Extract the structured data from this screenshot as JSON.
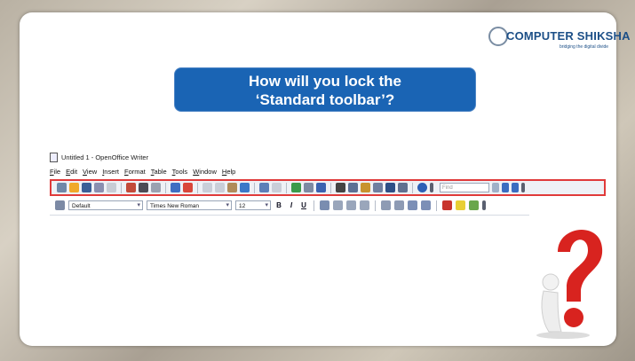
{
  "logo": {
    "name": "COMPUTER SHIKSHA",
    "tagline": "bridging the digital divide"
  },
  "question": {
    "line1": "How will you lock the",
    "line2": "‘Standard toolbar’?"
  },
  "app": {
    "window_title": "Untitled 1 - OpenOffice Writer",
    "menu": [
      "File",
      "Edit",
      "View",
      "Insert",
      "Format",
      "Table",
      "Tools",
      "Window",
      "Help"
    ],
    "find_placeholder": "Find"
  },
  "formatting": {
    "style": "Default",
    "font": "Times New Roman",
    "size": "12",
    "bold": "B",
    "italic": "I",
    "underline": "U"
  },
  "colors": {
    "title_bg": "#1a64b4",
    "highlight": "#e03a3a",
    "question_mark": "#d8231f"
  }
}
